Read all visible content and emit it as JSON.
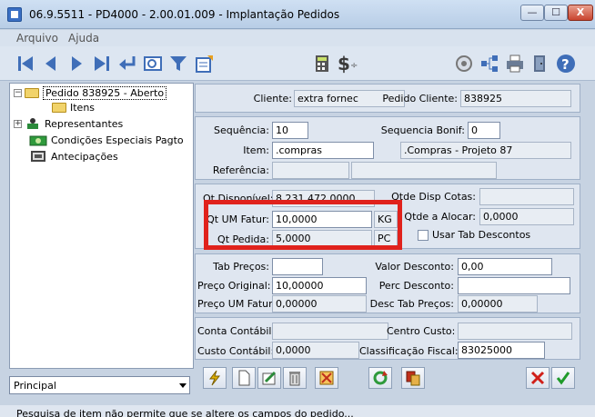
{
  "window": {
    "title": "06.9.5511 - PD4000 - 2.00.01.009 - Implantação Pedidos",
    "min_label": "—",
    "max_label": "☐",
    "close_label": "X"
  },
  "menu": {
    "items": [
      "Arquivo",
      "Ajuda"
    ]
  },
  "tree": {
    "items": [
      {
        "label": "Pedido 838925 - Aberto",
        "icon": "folder-icon"
      },
      {
        "label": "Itens",
        "icon": "folder-icon"
      },
      {
        "label": "Representantes",
        "icon": "representatives-icon"
      },
      {
        "label": "Condições Especiais Pagto",
        "icon": "payment-conditions-icon"
      },
      {
        "label": "Antecipações",
        "icon": "advance-payments-icon"
      }
    ],
    "expander": "+"
  },
  "principal_select": {
    "value": "Principal"
  },
  "header": {
    "cliente_label": "Cliente:",
    "cliente_value": "extra fornec",
    "pedido_cliente_label": "Pedido Cliente:",
    "pedido_cliente_value": "838925"
  },
  "item": {
    "sequencia_label": "Sequência:",
    "sequencia_value": "10",
    "sequencia_bonif_label": "Sequencia Bonif:",
    "sequencia_bonif_value": "0",
    "item_label": "Item:",
    "item_value": ".compras",
    "item_desc": ".Compras - Projeto 87",
    "referencia_label": "Referência:"
  },
  "quantities": {
    "qt_disponivel_label": "Qt Disponível:",
    "qt_disponivel_value": "8.231.472,0000",
    "qtde_disp_cotas_label": "Qtde Disp Cotas:",
    "qt_um_fatur_label": "Qt UM Fatur:",
    "qt_um_fatur_value": "10,0000",
    "qt_um_fatur_unit": "KG",
    "qtde_alocar_label": "Qtde a Alocar:",
    "qtde_alocar_value": "0,0000",
    "qt_pedida_label": "Qt Pedida:",
    "qt_pedida_value": "5,0000",
    "qt_pedida_unit": "PC",
    "usar_tab_descontos_label": "Usar Tab Descontos"
  },
  "prices": {
    "tab_precos_label": "Tab Preços:",
    "valor_desconto_label": "Valor Desconto:",
    "valor_desconto_value": "0,00",
    "preco_original_label": "Preço Original:",
    "preco_original_value": "10,00000",
    "perc_desconto_label": "Perc Desconto:",
    "preco_um_fatur_label": "Preço UM Fatur:",
    "preco_um_fatur_value": "0,00000",
    "desc_tab_precos_label": "Desc Tab Preços:",
    "desc_tab_precos_value": "0,00000"
  },
  "accounting": {
    "conta_contabil_label": "Conta Contábil:",
    "centro_custo_label": "Centro Custo:",
    "custo_contabil_label": "Custo Contábil:",
    "custo_contabil_value": "0,0000",
    "classificacao_fiscal_label": "Classificação Fiscal:",
    "classificacao_fiscal_value": "83025000"
  },
  "status": {
    "text": "Pesquisa de item não permite que se altere os campos do pedido..."
  },
  "colors": {
    "highlight": "#e0221c",
    "accent": "#3a6fc4"
  }
}
